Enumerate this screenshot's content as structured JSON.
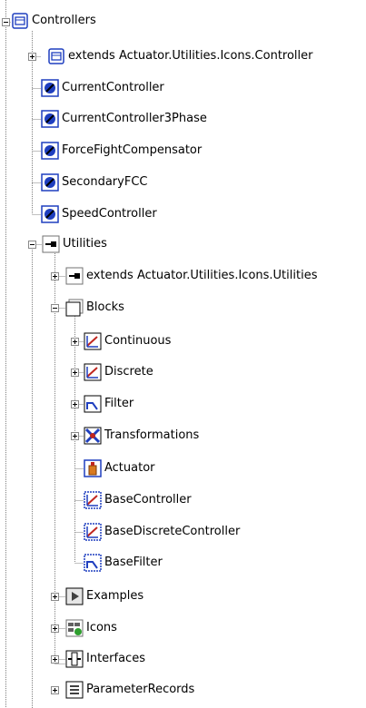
{
  "tree": {
    "controllers": {
      "label": "Controllers",
      "extends": "extends Actuator.Utilities.Icons.Controller",
      "items": [
        "CurrentController",
        "CurrentController3Phase",
        "ForceFightCompensator",
        "SecondaryFCC",
        "SpeedController"
      ]
    },
    "utilities": {
      "label": "Utilities",
      "extends": "extends Actuator.Utilities.Icons.Utilities",
      "blocks": {
        "label": "Blocks",
        "packages": [
          "Continuous",
          "Discrete",
          "Filter",
          "Transformations"
        ],
        "items": [
          "Actuator",
          "BaseController",
          "BaseDiscreteController",
          "BaseFilter"
        ]
      },
      "packages": [
        "Examples",
        "Icons",
        "Interfaces",
        "ParameterRecords"
      ]
    }
  },
  "colors": {
    "tree_line": "#808080",
    "expander_border": "#8a8a8a",
    "icon_blue": "#1f3fbf",
    "icon_red": "#c0261f"
  },
  "icons": {
    "package": "package-icon",
    "controller": "controller-icon",
    "utilities": "utilities-icon",
    "blocks": "blocks-icon",
    "block": "block-icon",
    "transform": "transformations-icon",
    "actuator": "actuator-icon",
    "examples": "examples-icon",
    "icons": "icons-package-icon",
    "interfaces": "interfaces-icon",
    "records": "records-icon"
  }
}
